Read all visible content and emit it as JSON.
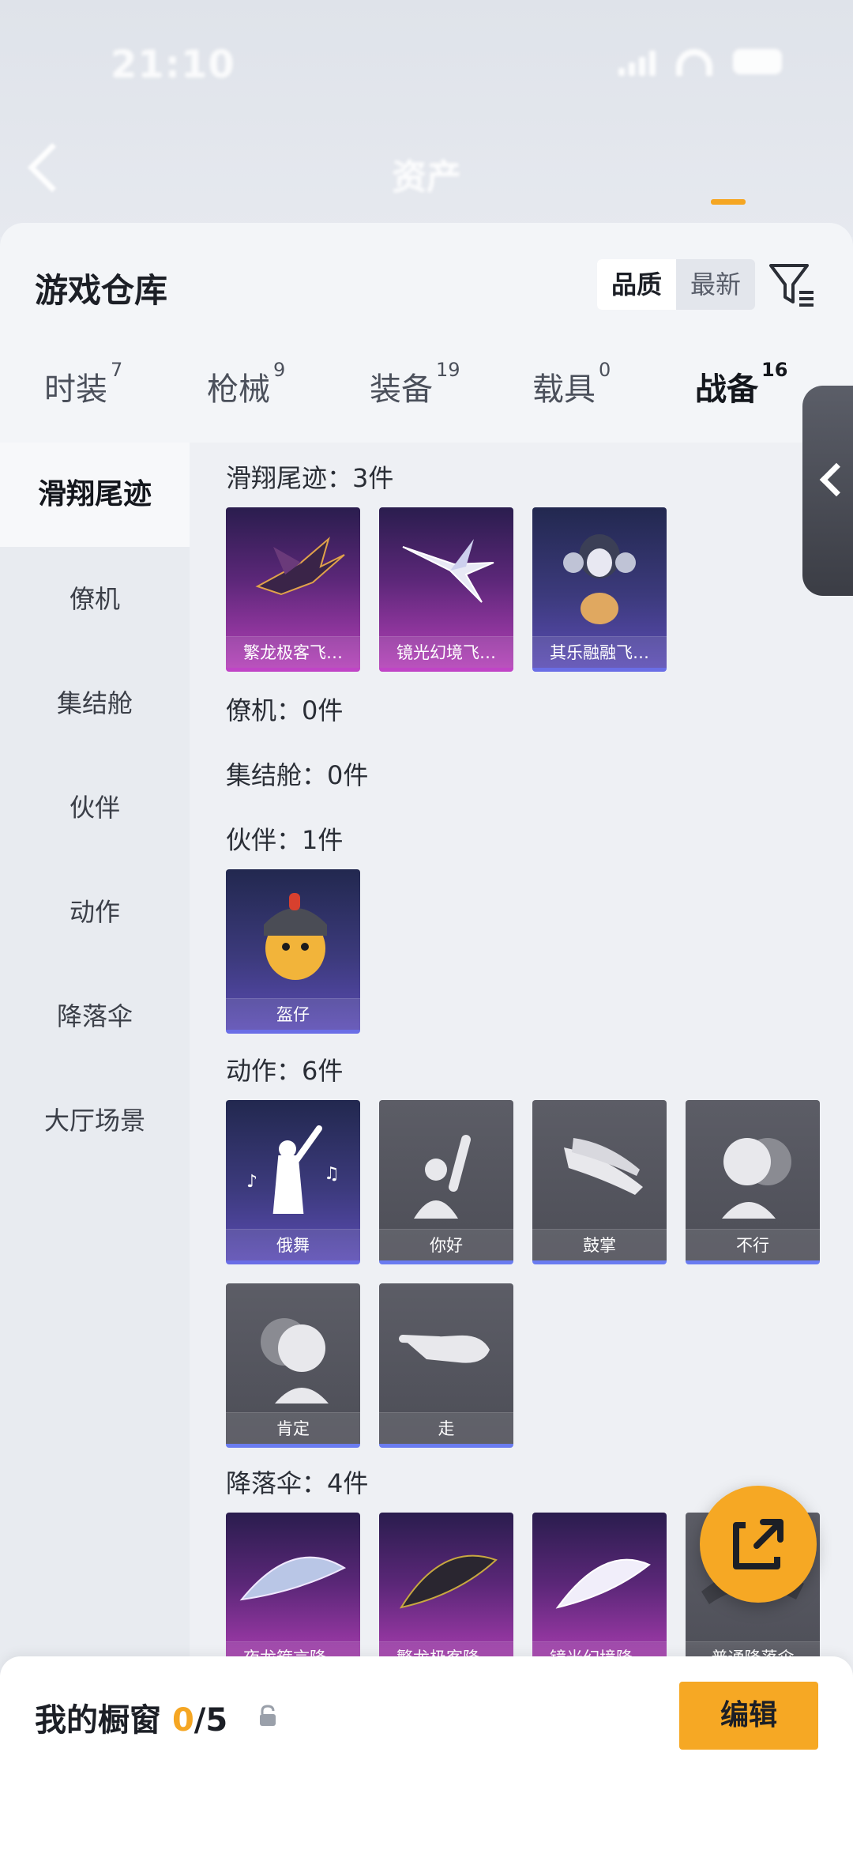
{
  "status": {
    "time": "21:10"
  },
  "header": {
    "title": "资产"
  },
  "sheet": {
    "title": "游戏仓库",
    "sort_options": [
      "品质",
      "最新"
    ],
    "active_sort": "品质"
  },
  "tabs": [
    {
      "label": "时装",
      "count": "7"
    },
    {
      "label": "枪械",
      "count": "9"
    },
    {
      "label": "装备",
      "count": "19"
    },
    {
      "label": "载具",
      "count": "0"
    },
    {
      "label": "战备",
      "count": "16"
    }
  ],
  "active_tab": "战备",
  "categories": [
    "滑翔尾迹",
    "僚机",
    "集结舱",
    "伙伴",
    "动作",
    "降落伞",
    "大厅场景"
  ],
  "active_category": "滑翔尾迹",
  "sections": {
    "glide": {
      "title": "滑翔尾迹：3件",
      "items": [
        "繁龙极客飞…",
        "镜光幻境飞…",
        "其乐融融飞…"
      ]
    },
    "wingman": {
      "title": "僚机：0件"
    },
    "pod": {
      "title": "集结舱：0件"
    },
    "partner": {
      "title": "伙伴：1件",
      "items": [
        "盔仔"
      ]
    },
    "emote": {
      "title": "动作：6件",
      "items": [
        "俄舞",
        "你好",
        "鼓掌",
        "不行",
        "肯定",
        "走"
      ]
    },
    "parachute": {
      "title": "降落伞：4件",
      "items": [
        "夜龙箍言降…",
        "繁龙极客降…",
        "镜光幻境降…",
        "普通降落伞"
      ]
    }
  },
  "showcase": {
    "label": "我的橱窗",
    "current": "0",
    "total": "/5"
  },
  "edit_label": "编辑",
  "colors": {
    "accent": "#f6a824",
    "rare_purple": "#b23fb6",
    "indigo": "#5a4bb3"
  }
}
